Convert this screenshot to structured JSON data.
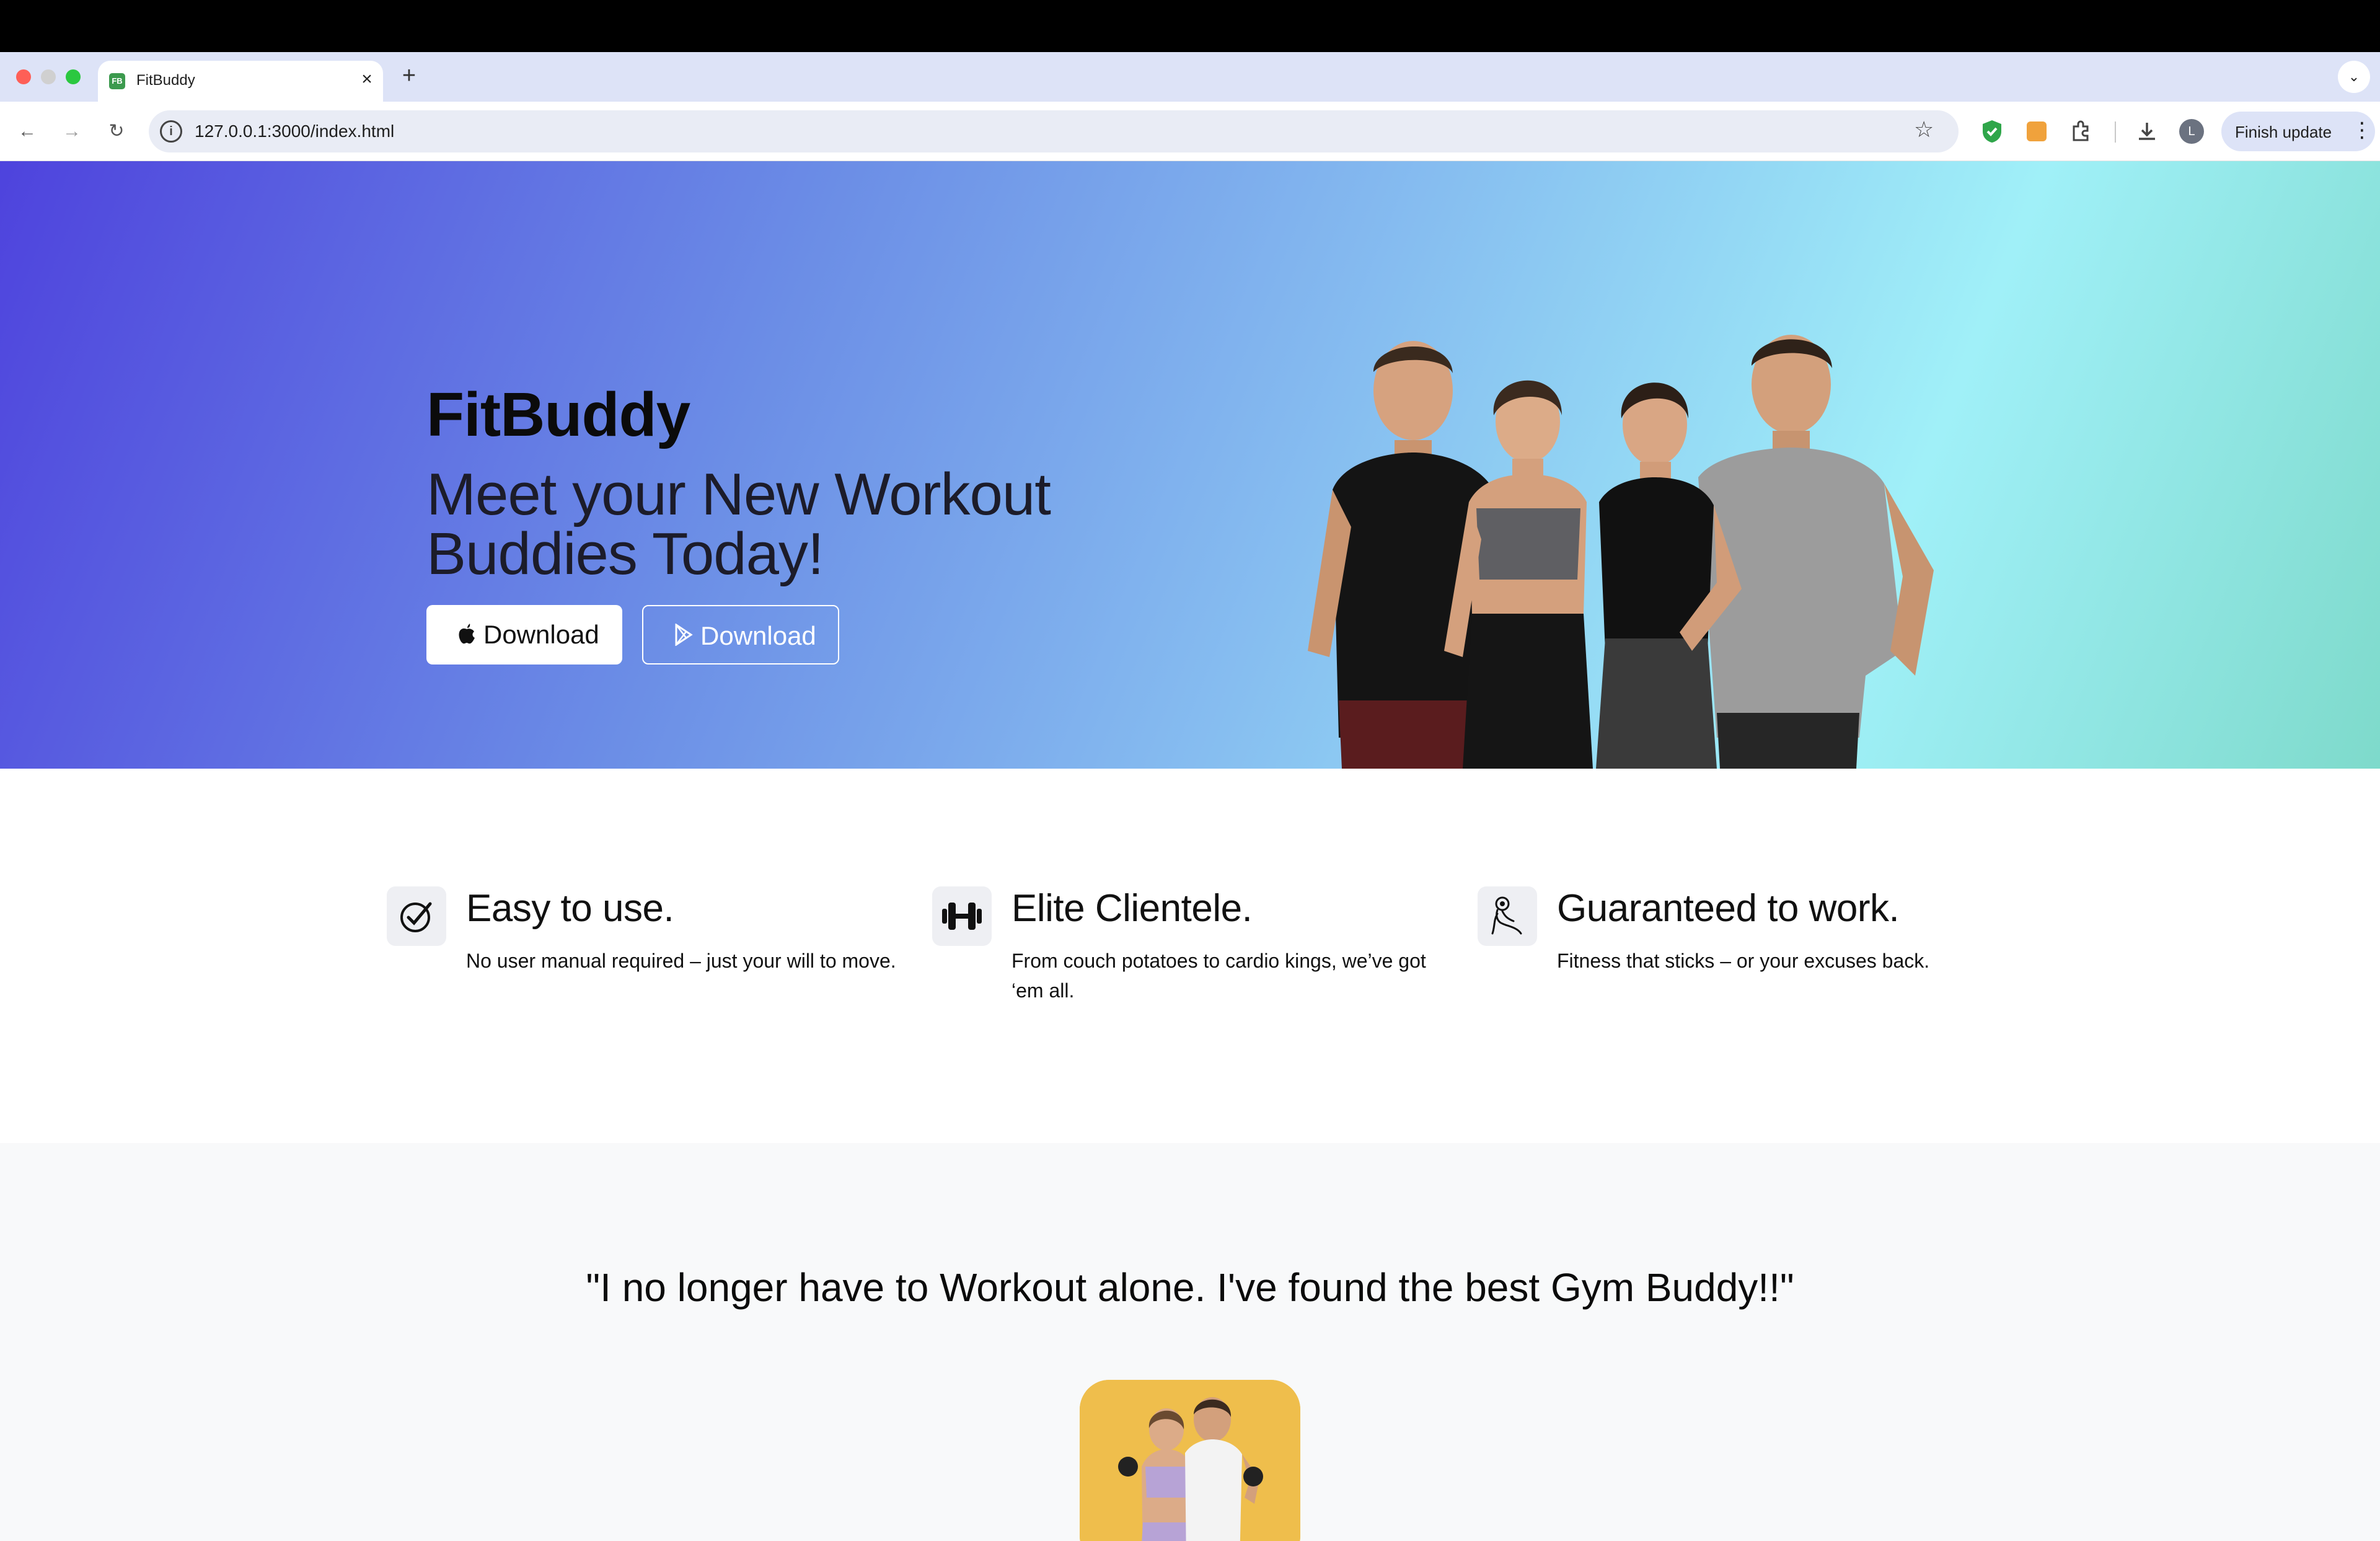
{
  "browser": {
    "tab_title": "FitBuddy",
    "tab_favicon_text": "FB",
    "url": "127.0.0.1:3000/index.html",
    "profile_initial": "L",
    "finish_update_label": "Finish update"
  },
  "hero": {
    "title": "FitBuddy",
    "subtitle": "Meet your New Workout Buddies Today!",
    "apple_download_label": "Download",
    "play_download_label": "Download"
  },
  "features": [
    {
      "icon": "check-circle-icon",
      "title": "Easy to use.",
      "description": "No user manual required – just your will to move."
    },
    {
      "icon": "dumbbell-icon",
      "title": "Elite Clientele.",
      "description": "From couch potatoes to cardio kings, we’ve got ‘em all."
    },
    {
      "icon": "flexed-arm-icon",
      "title": "Guaranteed to work.",
      "description": "Fitness that sticks – or your excuses back."
    }
  ],
  "testimonial": {
    "quote": "\"I no longer have to Workout alone. I've found the best Gym Buddy!!\""
  },
  "colors": {
    "hero_gradient_start": "#4e43dd",
    "hero_gradient_end": "#7edacb",
    "testimonial_bg": "#f8f9fa",
    "testimonial_image_bg": "#efbe4c"
  }
}
